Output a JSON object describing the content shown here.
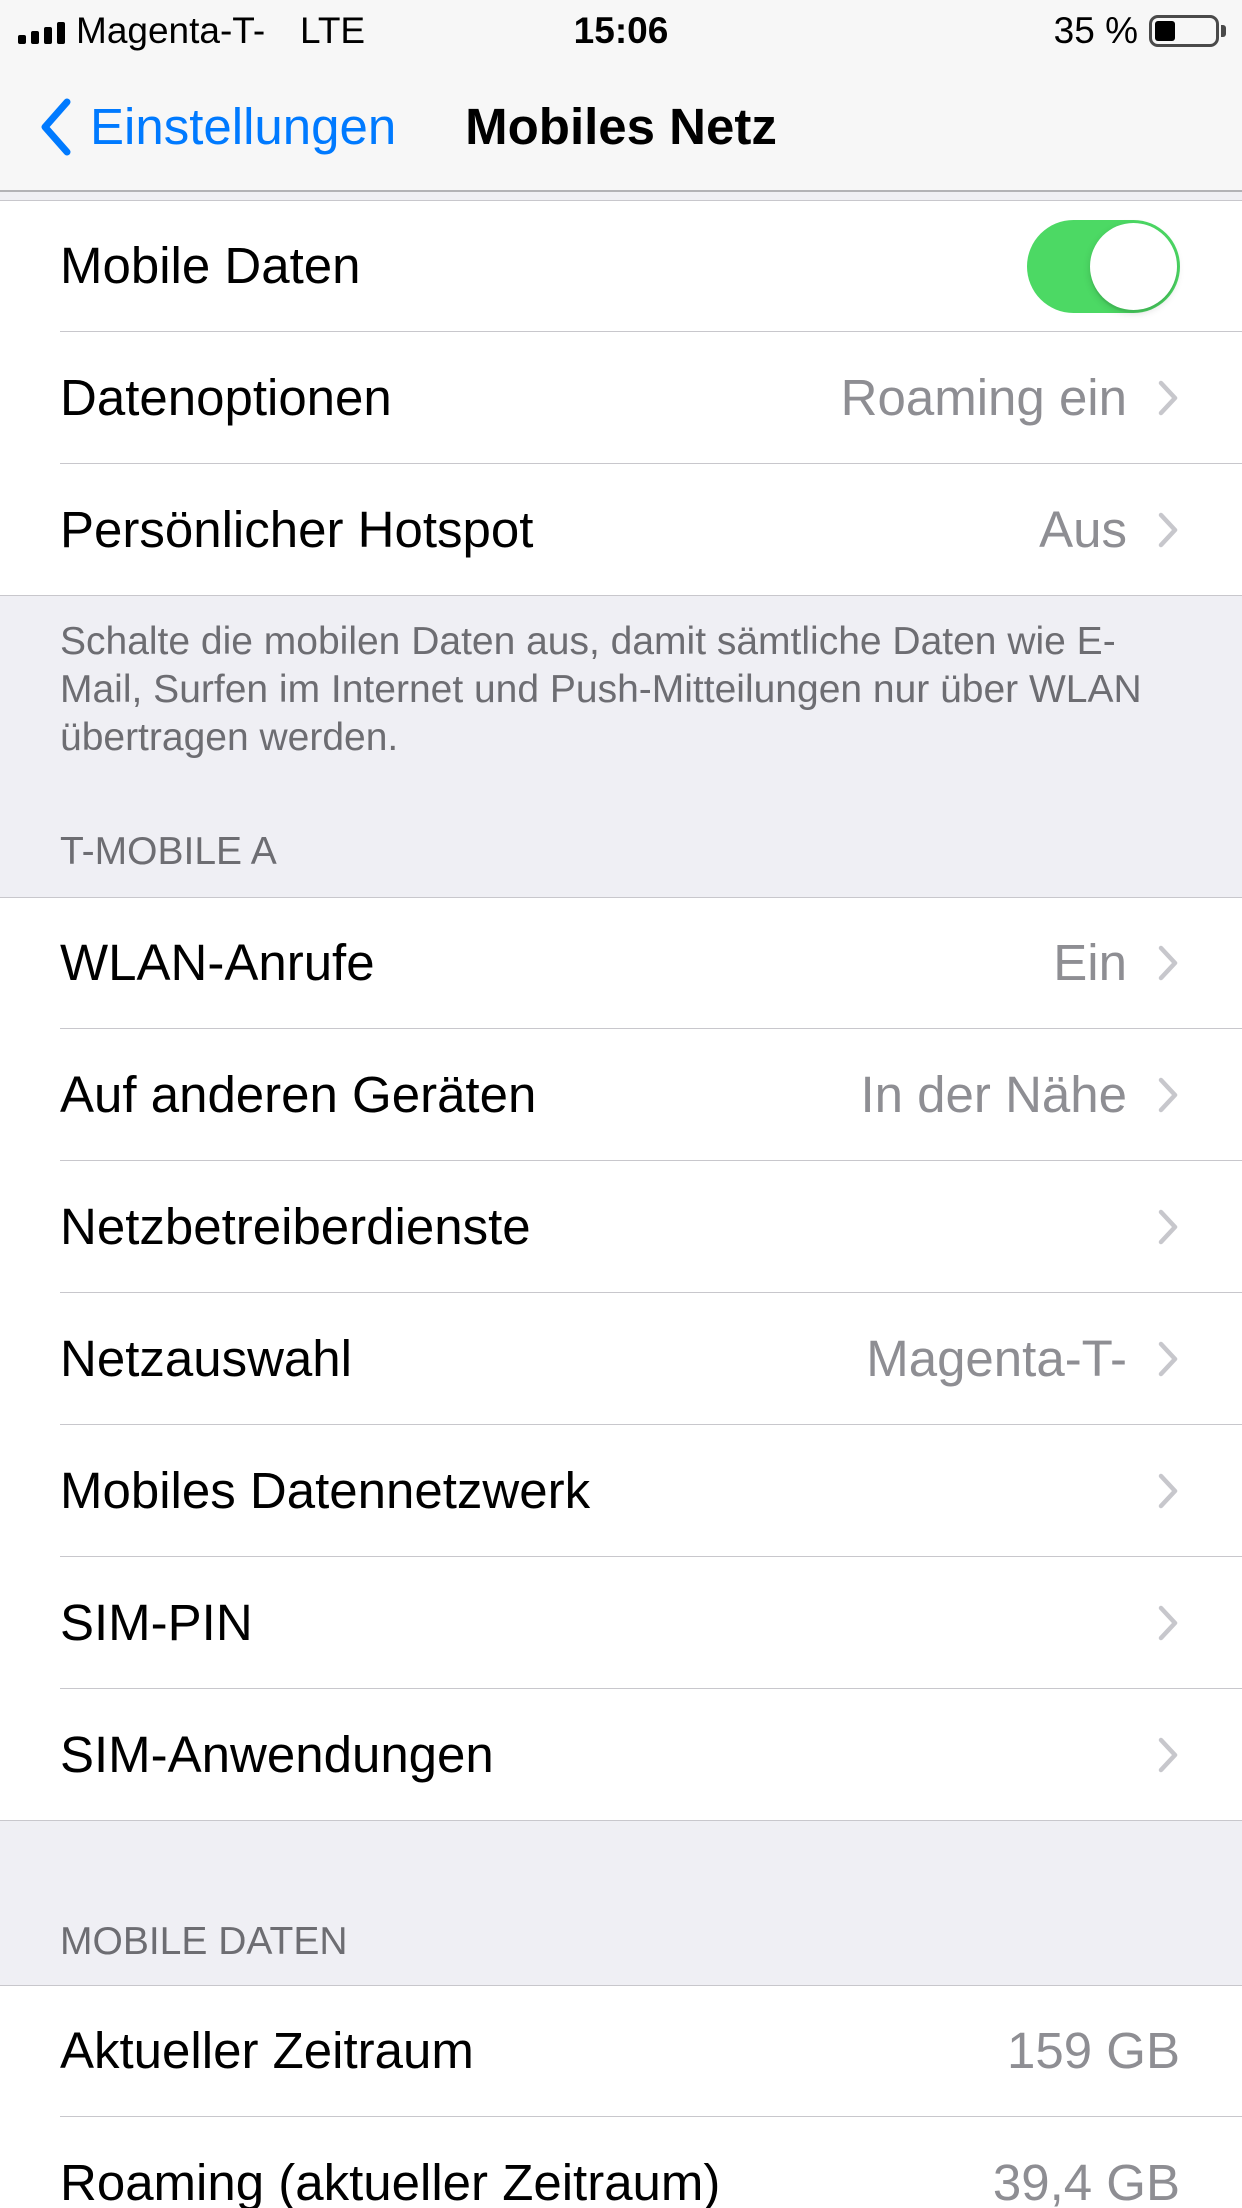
{
  "status_bar": {
    "carrier": "Magenta-T-",
    "network_type": "LTE",
    "time": "15:06",
    "battery_text": "35 %",
    "battery_level": 0.35,
    "signal_bars_filled": 4
  },
  "nav": {
    "back_label": "Einstellungen",
    "title": "Mobiles Netz"
  },
  "mobile_data_section": {
    "rows": [
      {
        "label": "Mobile Daten",
        "toggle_on": true
      },
      {
        "label": "Datenoptionen",
        "value": "Roaming ein",
        "disclosure": true
      },
      {
        "label": "Persönlicher Hotspot",
        "value": "Aus",
        "disclosure": true
      }
    ],
    "footer": "Schalte die mobilen Daten aus, damit sämtliche Daten wie E-Mail, Surfen im Internet und Push-Mitteilungen nur über WLAN übertragen werden."
  },
  "carrier_section": {
    "header": "T-MOBILE A",
    "rows": [
      {
        "label": "WLAN-Anrufe",
        "value": "Ein",
        "disclosure": true
      },
      {
        "label": "Auf anderen Geräten",
        "value": "In der Nähe",
        "disclosure": true
      },
      {
        "label": "Netzbetreiberdienste",
        "disclosure": true
      },
      {
        "label": "Netzauswahl",
        "value": "Magenta-T-",
        "disclosure": true
      },
      {
        "label": "Mobiles Datennetzwerk",
        "disclosure": true
      },
      {
        "label": "SIM-PIN",
        "disclosure": true
      },
      {
        "label": "SIM-Anwendungen",
        "disclosure": true
      }
    ]
  },
  "usage_section": {
    "header": "MOBILE DATEN",
    "rows": [
      {
        "label": "Aktueller Zeitraum",
        "value": "159 GB"
      },
      {
        "label": "Roaming (aktueller Zeitraum)",
        "value": "39,4 GB"
      }
    ]
  },
  "icons": {
    "signal": "cellular-signal-icon",
    "battery": "battery-icon",
    "back": "chevron-left-icon",
    "disclosure": "chevron-right-icon"
  },
  "colors": {
    "accent": "#007aff",
    "switch_on": "#4cd964",
    "background": "#efeff4",
    "bar_background": "#f7f7f7",
    "cell_background": "#ffffff",
    "primary_text": "#000000",
    "secondary_text": "#8e8e93",
    "section_text": "#6d6d72",
    "separator": "#c8c7cc",
    "chevron": "#c7c7cc"
  }
}
